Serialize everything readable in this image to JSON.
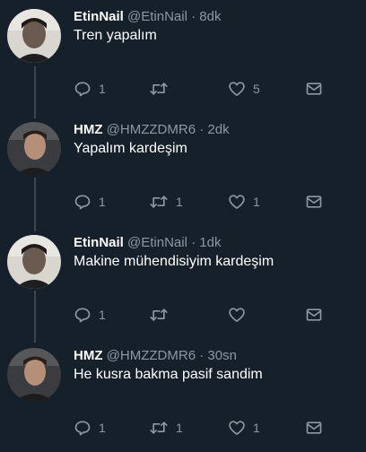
{
  "tweets": [
    {
      "name": "EtinNail",
      "handle": "@EtinNail",
      "time": "8dk",
      "text": "Tren yapalım",
      "reply_count": "1",
      "retweet_count": "",
      "like_count": "5",
      "avatar": "avatar-etinnail"
    },
    {
      "name": "HMZ",
      "handle": "@HMZZDMR6",
      "time": "2dk",
      "text": "Yapalım kardeşim",
      "reply_count": "1",
      "retweet_count": "1",
      "like_count": "1",
      "avatar": "avatar-hmz"
    },
    {
      "name": "EtinNail",
      "handle": "@EtinNail",
      "time": "1dk",
      "text": "Makine mühendisiyim kardeşim",
      "reply_count": "1",
      "retweet_count": "",
      "like_count": "",
      "avatar": "avatar-etinnail"
    },
    {
      "name": "HMZ",
      "handle": "@HMZZDMR6",
      "time": "30sn",
      "text": "He kusra bakma pasif sandim",
      "reply_count": "1",
      "retweet_count": "1",
      "like_count": "1",
      "avatar": "avatar-hmz"
    }
  ],
  "separator": " · ",
  "colors": {
    "background": "#16202b",
    "secondary_text": "#8b98a5",
    "thread_line": "#3a4654"
  },
  "icons": {
    "reply": "reply-icon",
    "retweet": "retweet-icon",
    "like": "heart-icon",
    "dm": "envelope-icon"
  }
}
